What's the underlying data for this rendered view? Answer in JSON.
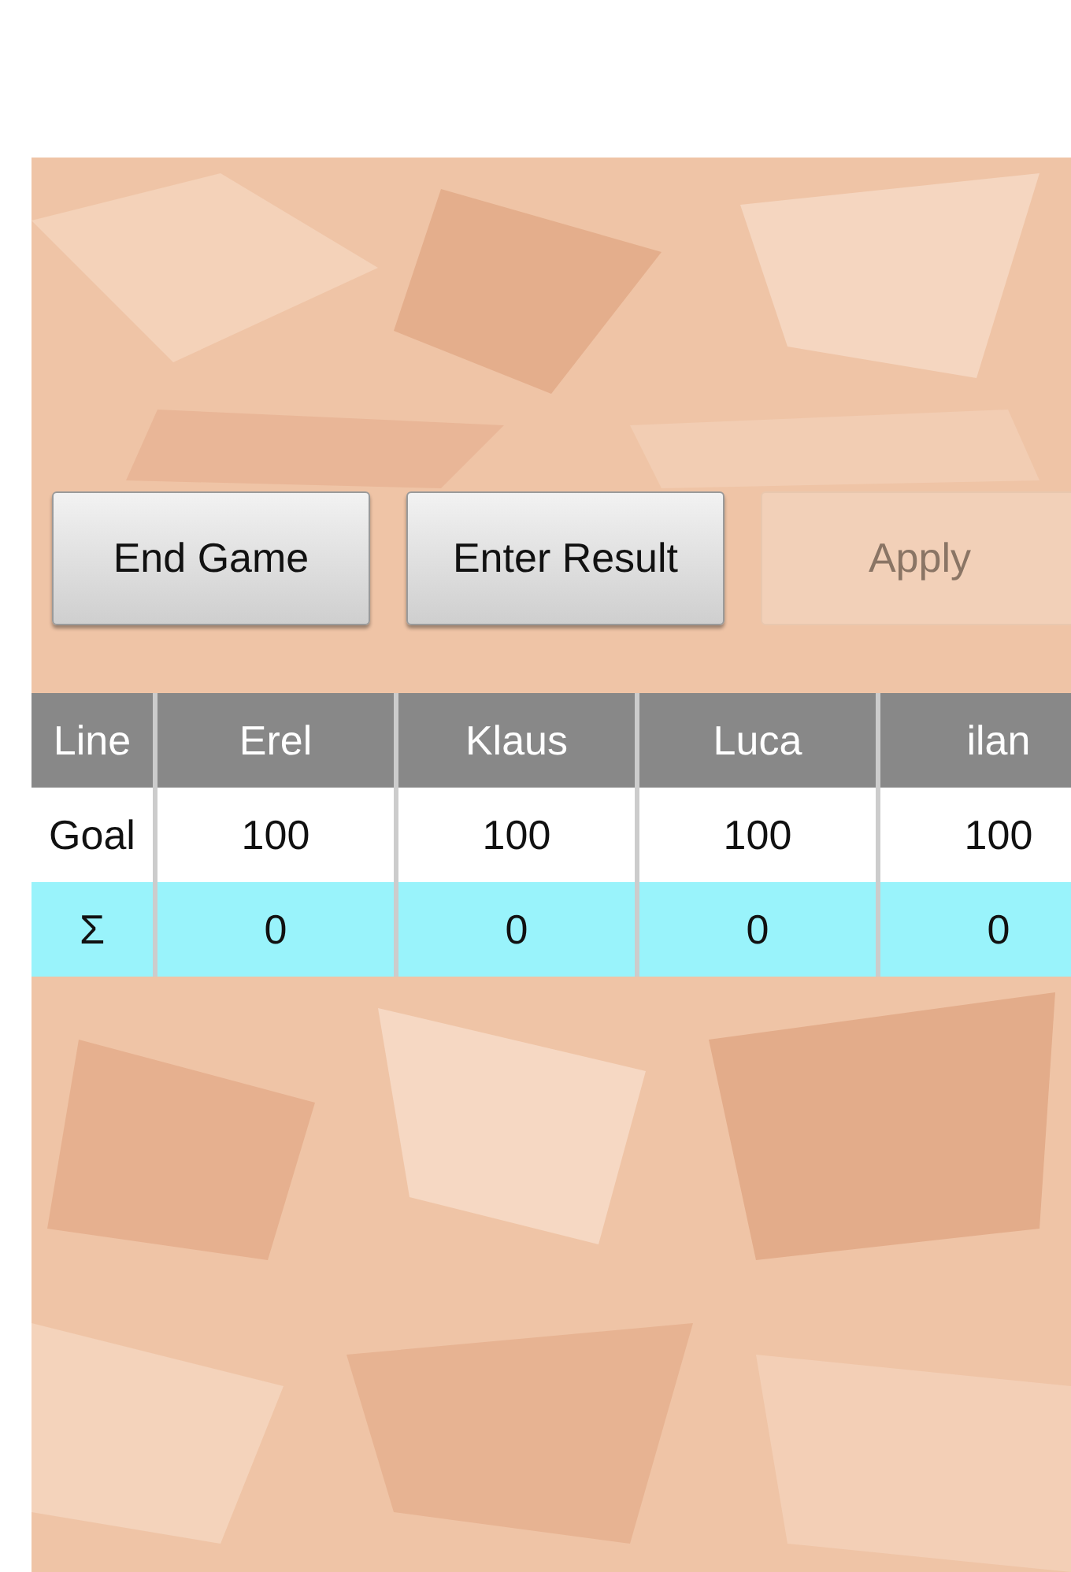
{
  "buttons": [
    {
      "label": "End Game",
      "disabled": false
    },
    {
      "label": "Enter Result",
      "disabled": false
    },
    {
      "label": "Apply",
      "disabled": true
    }
  ],
  "table": {
    "columns": [
      "Line",
      "Erel",
      "Klaus",
      "Luca",
      "ilan"
    ],
    "rows": [
      {
        "kind": "goal",
        "cells": [
          "Goal",
          "100",
          "100",
          "100",
          "100"
        ]
      },
      {
        "kind": "sum",
        "cells": [
          "Σ",
          "0",
          "0",
          "0",
          "0"
        ]
      }
    ]
  }
}
